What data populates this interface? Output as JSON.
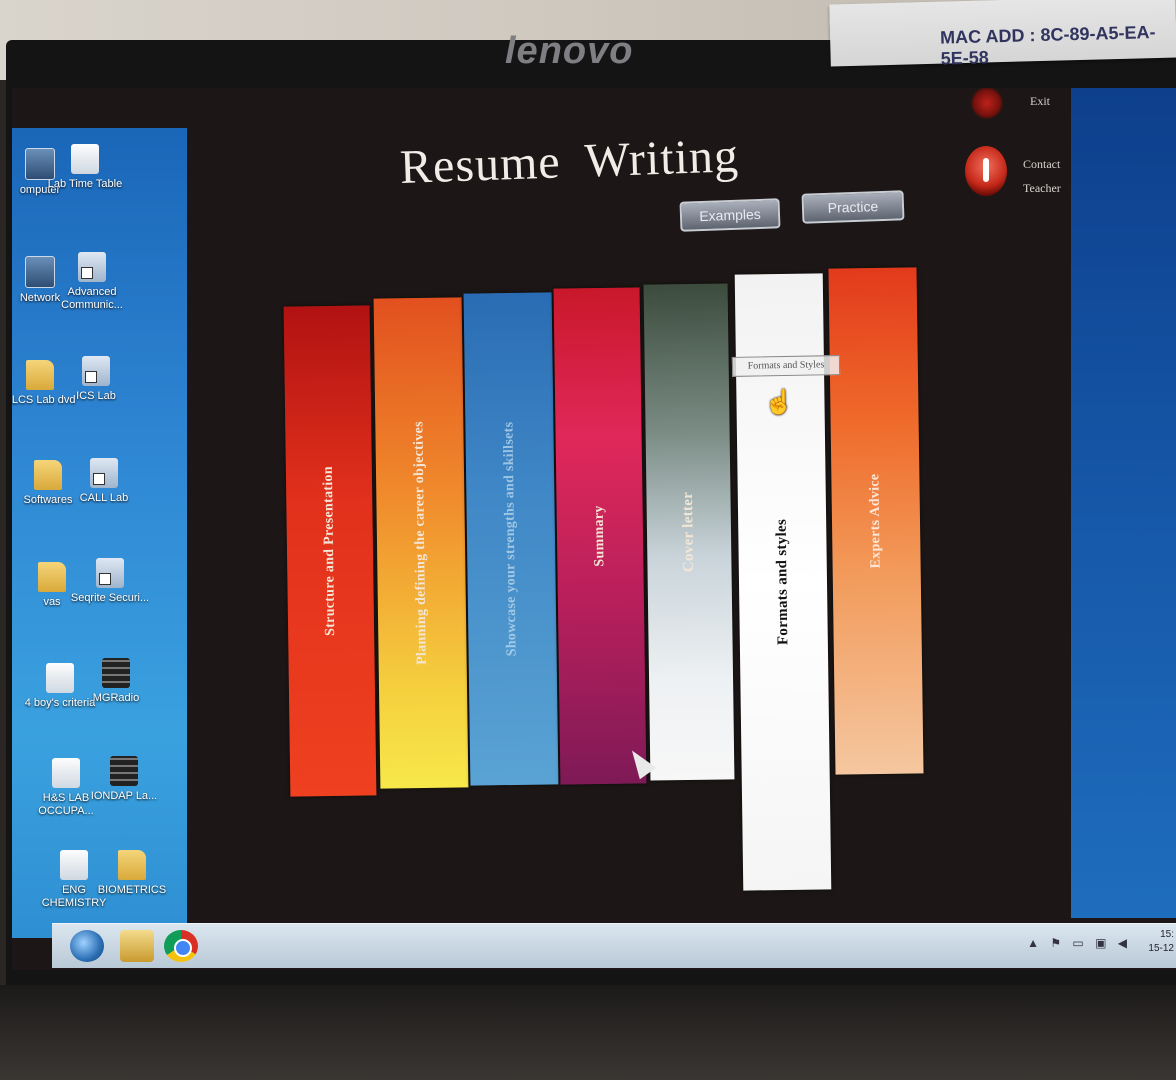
{
  "monitor": {
    "brand": "lenovo",
    "sticker_line1": "",
    "sticker_line2": "MAC ADD : 8C-89-A5-EA-5E-58"
  },
  "desktop": {
    "icons": [
      {
        "label": "omputer",
        "icon": "computer-icon"
      },
      {
        "label": "Lab Time Table",
        "icon": "document-icon"
      },
      {
        "label": "Network",
        "icon": "network-icon"
      },
      {
        "label": "Advanced Communic...",
        "icon": "shortcut-icon"
      },
      {
        "label": "ELCS Lab dvd",
        "icon": "folder-icon"
      },
      {
        "label": "ICS Lab",
        "icon": "shortcut-icon"
      },
      {
        "label": "Softwares",
        "icon": "folder-icon"
      },
      {
        "label": "CALL Lab",
        "icon": "shortcut-icon"
      },
      {
        "label": "vas",
        "icon": "folder-icon"
      },
      {
        "label": "Seqrite Securi...",
        "icon": "shortcut-icon"
      },
      {
        "label": "4 boy's criteria",
        "icon": "document-icon"
      },
      {
        "label": "MGRadio",
        "icon": "media-icon"
      },
      {
        "label": "H&S LAB OCCUPA...",
        "icon": "document-icon"
      },
      {
        "label": "IONDAP La...",
        "icon": "media-icon"
      },
      {
        "label": "ENG CHEMISTRY",
        "icon": "document-icon"
      },
      {
        "label": "BIOMETRICS",
        "icon": "folder-icon"
      }
    ]
  },
  "app": {
    "title_word1": "Resume",
    "title_word2": "Writing",
    "examples_button": "Examples",
    "practice_button": "Practice",
    "exit_label": "Exit",
    "contact_label_1": "Contact",
    "contact_label_2": "Teacher",
    "tooltip": "Formats and Styles",
    "bars": [
      {
        "label": "Structure and Presentation"
      },
      {
        "label": "Planning defining the career objectives"
      },
      {
        "label": "Showcase your strengths and skillsets"
      },
      {
        "label": "Summary"
      },
      {
        "label": "Cover letter"
      },
      {
        "label": "Formats and styles"
      },
      {
        "label": "Experts Advice"
      }
    ]
  },
  "taskbar": {
    "clock_time": "15:",
    "clock_date": "15-12"
  }
}
